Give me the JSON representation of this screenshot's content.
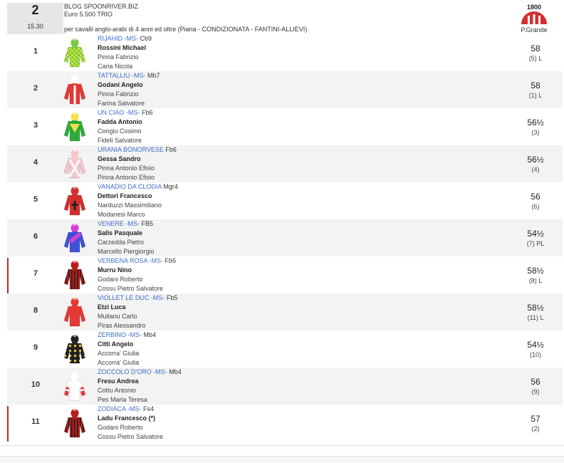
{
  "race": {
    "number": "2",
    "time": "15.30",
    "title": "BLOG SPOONRIVER.BIZ",
    "prize": "Euro 5.500 TRIO",
    "description": "per cavalli anglo-arabi di 4 anni ed oltre (Piana -  CONDIZIONATA  - FANTINI-ALLIEVI)",
    "track_year": "1800",
    "track": "P.Grande"
  },
  "runners": [
    {
      "num": "1",
      "horse": "RIJAHID -MS-",
      "sire": "Cb9",
      "jockey": "Rossini Michael",
      "trainer": "Pinna Fabrizio",
      "owner": "Caria Nicola",
      "weight": "58",
      "pos": "(5) L",
      "silk": {
        "body": "#7ac943",
        "accent": "#c8e63c",
        "cap": "#7ac943",
        "pattern": "check"
      }
    },
    {
      "num": "2",
      "horse": "TATTALLIU -MS-",
      "sire": "Mb7",
      "jockey": "Godani Angelo",
      "trainer": "Pinna Fabrizio",
      "owner": "Farina Salvatore",
      "weight": "58",
      "pos": "(1) L",
      "silk": {
        "body": "#e53935",
        "accent": "#ffffff",
        "cap": "#ffffff",
        "pattern": "stripe"
      }
    },
    {
      "num": "3",
      "horse": "UN CIAO -MS-",
      "sire": "Fb6",
      "jockey": "Fadda Antonio",
      "trainer": "Congiu Cosimo",
      "owner": "Fideli Salvatore",
      "weight": "56½",
      "pos": "(3)",
      "silk": {
        "body": "#2eaa3a",
        "accent": "#f4e04d",
        "cap": "#f4e04d",
        "pattern": "diamond"
      }
    },
    {
      "num": "4",
      "horse": "URANIA BONORVESE",
      "sire": "Fb6",
      "jockey": "Gessa Sandro",
      "trainer": "Pinna Antonio Efisio",
      "owner": "Pinna Antonio Efisio",
      "weight": "56½",
      "pos": "(4)",
      "silk": {
        "body": "#f4c6cc",
        "accent": "#ffffff",
        "cap": "#f4c6cc",
        "pattern": "cross"
      }
    },
    {
      "num": "5",
      "horse": "VANADIO DA CLODIA",
      "sire": "Mgr4",
      "jockey": "Dettori Francesco",
      "trainer": "Narduzzi Massimiliano",
      "owner": "Modanesi Marco",
      "weight": "56",
      "pos": "(6)",
      "silk": {
        "body": "#d32f2f",
        "accent": "#222222",
        "cap": "#d32f2f",
        "pattern": "plain"
      }
    },
    {
      "num": "6",
      "horse": "VENERE -MS-",
      "sire": "FB5",
      "jockey": "Salis Pasquale",
      "trainer": "Carzedda Pietro",
      "owner": "Marcello Piergiorgio",
      "weight": "54½",
      "pos": "(7) PL",
      "silk": {
        "body": "#3f51d8",
        "accent": "#d63fd6",
        "cap": "#d63fd6",
        "pattern": "sash"
      }
    },
    {
      "num": "7",
      "horse": "VERBENA ROSA -MS-",
      "sire": "Fb5",
      "jockey": "Murru Nino",
      "trainer": "Godani Roberto",
      "owner": "Cossu Pietro Salvatore",
      "weight": "58½",
      "pos": "(8) L",
      "silk": {
        "body": "#b71c1c",
        "accent": "#222222",
        "cap": "#b71c1c",
        "pattern": "vstripes"
      }
    },
    {
      "num": "8",
      "horse": "VIOLLET LE DUC -MS-",
      "sire": "Fb5",
      "jockey": "Etzi Luca",
      "trainer": "Mullanu Carlo",
      "owner": "Piras Alessandro",
      "weight": "58½",
      "pos": "(11) L",
      "silk": {
        "body": "#e53935",
        "accent": "#e53935",
        "cap": "#e53935",
        "pattern": "plain"
      }
    },
    {
      "num": "9",
      "horse": "ZERBINO -MS-",
      "sire": "Mb4",
      "jockey": "Citti Angelo",
      "trainer": "Accorra' Giulia",
      "owner": "Accorra' Giulia",
      "weight": "54½",
      "pos": "(10)",
      "silk": {
        "body": "#222222",
        "accent": "#f4d03f",
        "cap": "#222222",
        "pattern": "dots"
      }
    },
    {
      "num": "10",
      "horse": "ZOCCOLO D'ORO -MS-",
      "sire": "Mb4",
      "jockey": "Fresu Andrea",
      "trainer": "Cottu Antonio",
      "owner": "Pes Maria Teresa",
      "weight": "56",
      "pos": "(9)",
      "silk": {
        "body": "#ffffff",
        "accent": "#e53935",
        "cap": "#ffffff",
        "pattern": "sleeves"
      }
    },
    {
      "num": "11",
      "horse": "ZODIACA -MS-",
      "sire": "Fs4",
      "jockey": "Ladu Francesco (*)",
      "trainer": "Godani Roberto",
      "owner": "Cossu Pietro Salvatore",
      "weight": "57",
      "pos": "(2)",
      "silk": {
        "body": "#b71c1c",
        "accent": "#222222",
        "cap": "#b71c1c",
        "pattern": "vstripes"
      }
    }
  ]
}
